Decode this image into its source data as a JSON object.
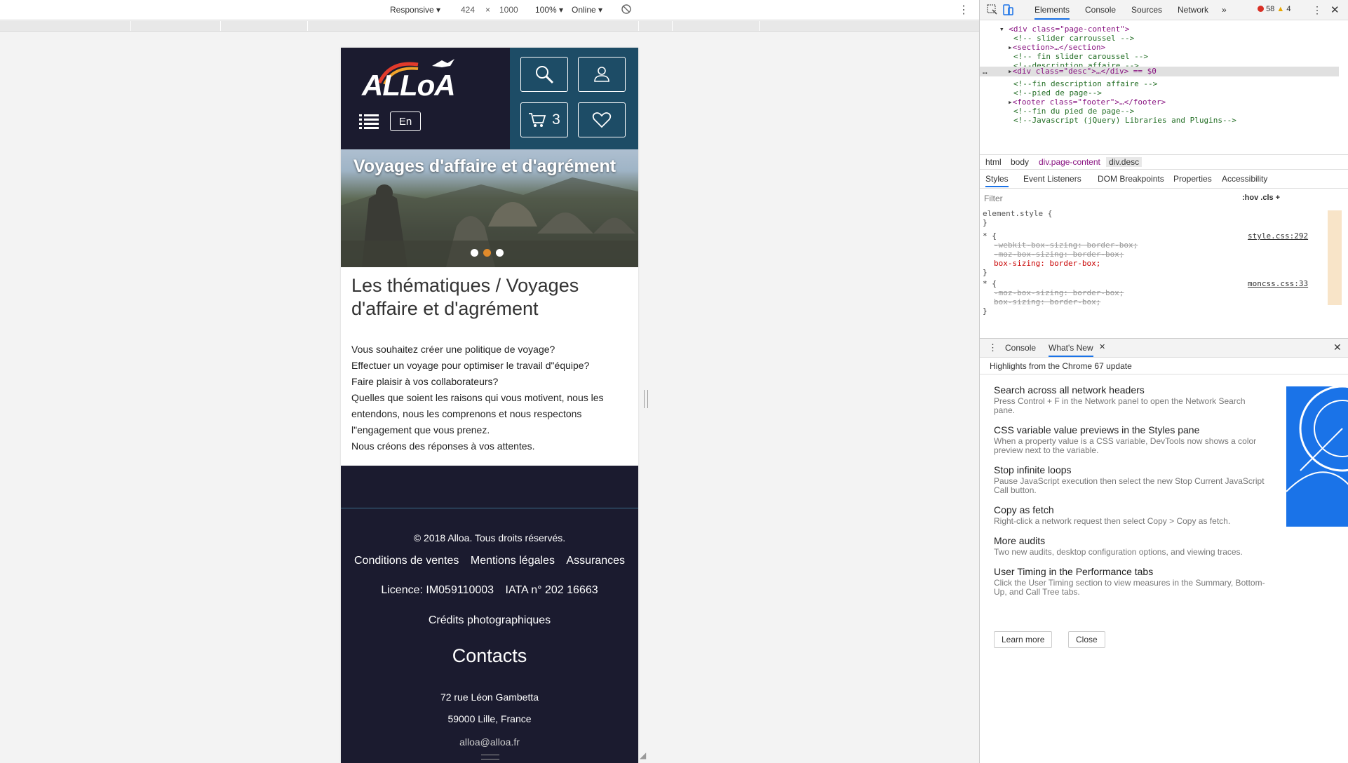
{
  "device_toolbar": {
    "device": "Responsive ▾",
    "width": "424",
    "times": "×",
    "height": "1000",
    "zoom": "100% ▾",
    "network": "Online ▾",
    "more": "⋮"
  },
  "site": {
    "logo_text": "ALLoA",
    "lang_label": "En",
    "cart_count": "3",
    "banner_title": "Voyages d'affaire et d'agrément",
    "heading": "Les thématiques / Voyages d'affaire et d'agrément",
    "desc_lines": [
      "Vous souhaitez créer une politique de voyage?",
      "Effectuer un voyage pour optimiser le travail d\"équipe?",
      "Faire plaisir à vos collaborateurs?",
      "Quelles que soient les raisons qui vous motivent, nous les",
      "entendons, nous les comprenons et nous respectons",
      "l\"engagement que vous prenez.",
      "Nous créons des réponses à vos attentes."
    ],
    "footer": {
      "copyright": "© 2018 Alloa. Tous droits réservés.",
      "links": [
        "Conditions de ventes",
        "Mentions légales",
        "Assurances"
      ],
      "licence": "Licence: IM059110003",
      "iata": "IATA n° 202 16663",
      "credits": "Crédits photographiques",
      "contacts_title": "Contacts",
      "address1": "72 rue Léon Gambetta",
      "address2": "59000 Lille, France",
      "email_partial": "alloa@alloa.fr"
    }
  },
  "devtools": {
    "tabs": [
      "Elements",
      "Console",
      "Sources",
      "Network",
      "»"
    ],
    "errors": "58",
    "warnings": "4",
    "dom": [
      {
        "type": "tag",
        "text": "<div class=\"page-content\">"
      },
      {
        "type": "cmt",
        "text": "<!-- slider carroussel -->"
      },
      {
        "type": "tag",
        "text": "<section>…</section>"
      },
      {
        "type": "cmt",
        "text": "<!-- fin slider caroussel -->"
      },
      {
        "type": "cmt",
        "text": "<!--description affaire -->"
      },
      {
        "type": "sel",
        "text": "<div class=\"desc\">…</div> == $0"
      },
      {
        "type": "cmt",
        "text": "<!--fin description affaire -->"
      },
      {
        "type": "cmt",
        "text": "<!--pied de page-->"
      },
      {
        "type": "tag",
        "text": "<footer class=\"footer\">…</footer>"
      },
      {
        "type": "cmt",
        "text": "<!--fin  du pied de page-->"
      },
      {
        "type": "cmt",
        "text": "<!--Javascript (jQuery) Libraries and Plugins-->"
      }
    ],
    "crumbs": [
      "html",
      "body",
      "div.page-content",
      "div.desc"
    ],
    "sub_tabs": [
      "Styles",
      "Event Listeners",
      "DOM Breakpoints",
      "Properties",
      "Accessibility"
    ],
    "filter_placeholder": "Filter",
    "filter_tools": ":hov  .cls  +",
    "styles": {
      "element_style": "element.style {",
      "close": "}",
      "rule1_selector": "* {",
      "rule1_source": "style.css:292",
      "rule1_props": [
        "-webkit-box-sizing: border-box;",
        "-moz-box-sizing: border-box;",
        "box-sizing: border-box;"
      ],
      "rule2_selector": "* {",
      "rule2_source": "moncss.css:33",
      "rule2_props": [
        "-moz-box-sizing: border-box;",
        "box-sizing: border-box;"
      ]
    },
    "drawer_tabs": [
      "Console",
      "What's New"
    ],
    "whats_new_header": "Highlights from the Chrome 67 update",
    "whats_new": [
      {
        "title": "Search across all network headers",
        "desc": "Press Control + F in the Network panel to open the Network Search pane."
      },
      {
        "title": "CSS variable value previews in the Styles pane",
        "desc": "When a property value is a CSS variable, DevTools now shows a color preview next to the variable."
      },
      {
        "title": "Stop infinite loops",
        "desc": "Pause JavaScript execution then select the new Stop Current JavaScript Call button."
      },
      {
        "title": "Copy as fetch",
        "desc": "Right-click a network request then select Copy > Copy as fetch."
      },
      {
        "title": "More audits",
        "desc": "Two new audits, desktop configuration options, and viewing traces."
      },
      {
        "title": "User Timing in the Performance tabs",
        "desc": "Click the User Timing section to view measures in the Summary, Bottom-Up, and Call Tree tabs."
      }
    ],
    "learn_more": "Learn more",
    "close": "Close"
  }
}
